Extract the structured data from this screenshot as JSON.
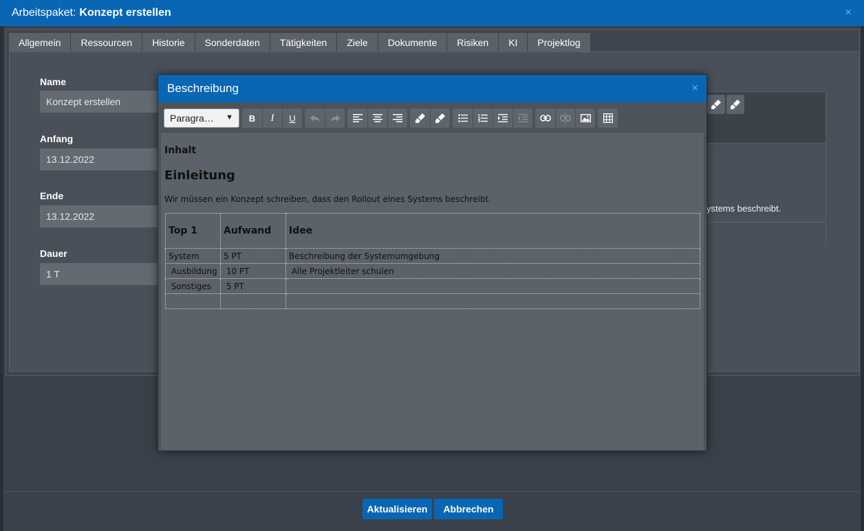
{
  "window": {
    "title_prefix": "Arbeitspaket:",
    "title_name": "Konzept erstellen",
    "close": "×"
  },
  "tabs": [
    "Allgemein",
    "Ressourcen",
    "Historie",
    "Sonderdaten",
    "Tätigkeiten",
    "Ziele",
    "Dokumente",
    "Risiken",
    "KI",
    "Projektlog"
  ],
  "form": {
    "name_label": "Name",
    "name_value": "Konzept erstellen",
    "start_label": "Anfang",
    "start_value": "13.12.2022",
    "end_label": "Ende",
    "end_value": "13.12.2022",
    "duration_label": "Dauer",
    "duration_value": "1 T"
  },
  "background_text": "ystems beschreibt.",
  "modal": {
    "title": "Beschreibung",
    "close": "×",
    "format_select": "Paragra…",
    "bold": "B",
    "italic": "I",
    "underline": "U"
  },
  "doc": {
    "heading_small": "Inhalt",
    "heading": "Einleitung",
    "paragraph": "Wir müssen ein Konzept schreiben, dass den Rollout eines Systems beschreibt.",
    "table": {
      "headers": [
        "Top 1",
        "Aufwand",
        "Idee"
      ],
      "rows": [
        [
          "System",
          "5 PT",
          "Beschreibung der Systemumgebung"
        ],
        [
          " Ausbildung",
          " 10 PT",
          " Alle Projektleiter schulen"
        ],
        [
          " Sonstiges",
          " 5 PT",
          ""
        ],
        [
          "",
          "",
          ""
        ]
      ]
    }
  },
  "buttons": {
    "update": "Aktualisieren",
    "cancel": "Abbrechen"
  },
  "colors": {
    "accent": "#0866b5",
    "panel": "#4a5059",
    "editor_bg": "#5c6269"
  }
}
